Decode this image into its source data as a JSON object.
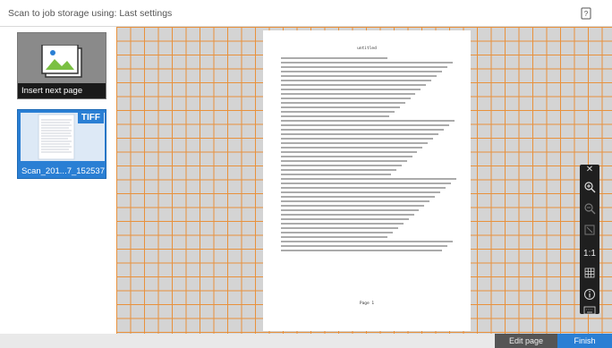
{
  "header": {
    "title": "Scan to job storage using: Last settings"
  },
  "sidebar": {
    "insert_label": "Insert next page",
    "thumb": {
      "badge": "TIFF",
      "filename": "Scan_201...7_152537"
    }
  },
  "document": {
    "heading": "untitled",
    "footer": "Page 1",
    "line_count": 44
  },
  "toolbar": {
    "one_to_one": "1:1",
    "collapse": "✕"
  },
  "footer": {
    "edit_label": "Edit page",
    "finish_label": "Finish"
  },
  "colors": {
    "accent": "#2a7fd4",
    "grid_line": "#e8913c",
    "canvas_bg": "#d4d4d4"
  }
}
